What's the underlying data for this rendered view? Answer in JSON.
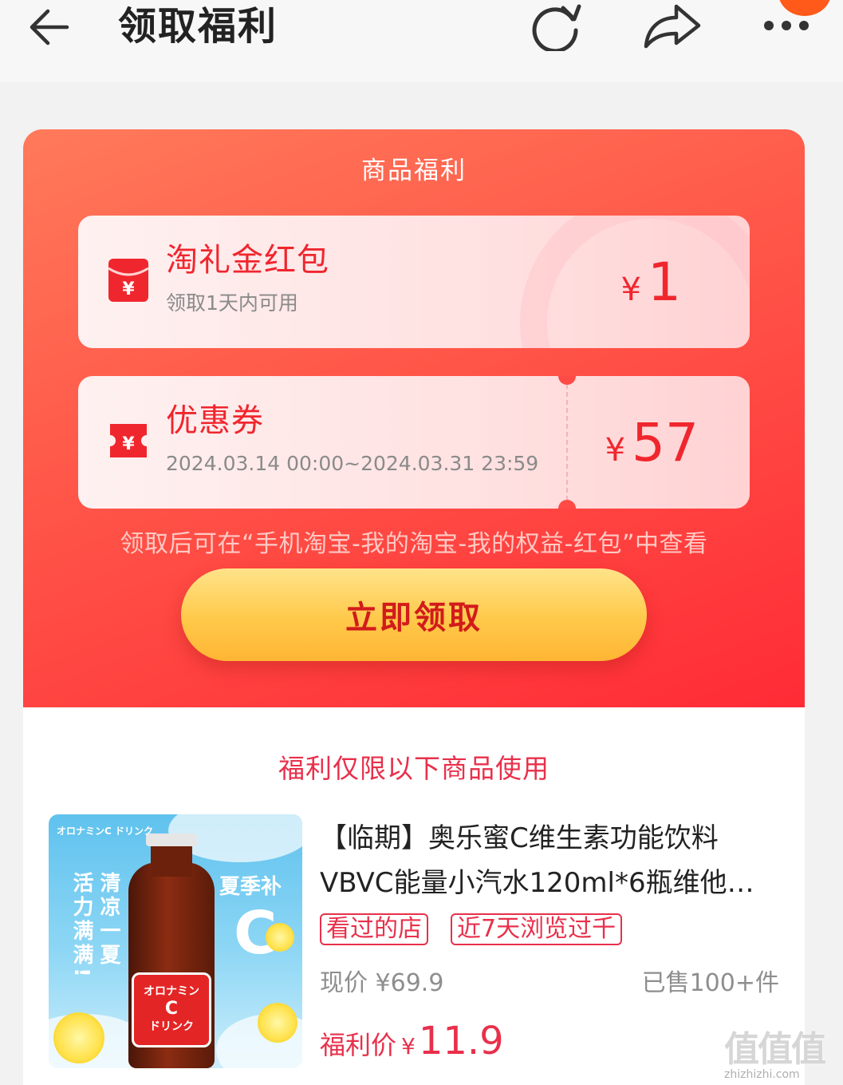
{
  "header": {
    "title": "领取福利"
  },
  "welfare": {
    "heading": "商品福利",
    "gift_card": {
      "name": "淘礼金红包",
      "subtitle": "领取1天内可用",
      "currency": "¥",
      "amount": "1"
    },
    "coupon": {
      "name": "优惠券",
      "validity": "2024.03.14 00:00~2024.03.31 23:59",
      "currency": "¥",
      "amount": "57"
    },
    "note": "领取后可在“手机淘宝-我的淘宝-我的权益-红包”中查看",
    "claim_button": "立即领取"
  },
  "products": {
    "heading": "福利仅限以下商品使用",
    "items": [
      {
        "title": "【临期】奥乐蜜C维生素功能饮料VBVC能量小汽水120ml*6瓶维他…",
        "tags": [
          "看过的店",
          "近7天浏览过千"
        ],
        "current_price_label": "现价",
        "current_price": "¥69.9",
        "sold": "已售100+件",
        "deal_price_label": "福利价",
        "deal_currency": "¥",
        "deal_price": "11.9",
        "image": {
          "brand": "オロナミンC ドリンク",
          "text_left": "活力满满!",
          "text_right": "清凉一夏",
          "badge": "夏季补",
          "big_letter": "C",
          "label_line1": "オロナミン",
          "label_line2": "C",
          "label_line3": "ドリンク"
        }
      }
    ]
  },
  "watermark": {
    "glyphs": "值值值",
    "url": "zhizhizhi.com"
  },
  "icons": {
    "back": "arrow-left-icon",
    "refresh": "refresh-icon",
    "share": "share-icon",
    "more": "more-dots-icon",
    "gift": "red-envelope-icon",
    "coupon": "ticket-icon"
  },
  "colors": {
    "accent_red": "#f0262e",
    "button_gold": "#ffc94a",
    "notification_orange": "#ff5a1a"
  }
}
